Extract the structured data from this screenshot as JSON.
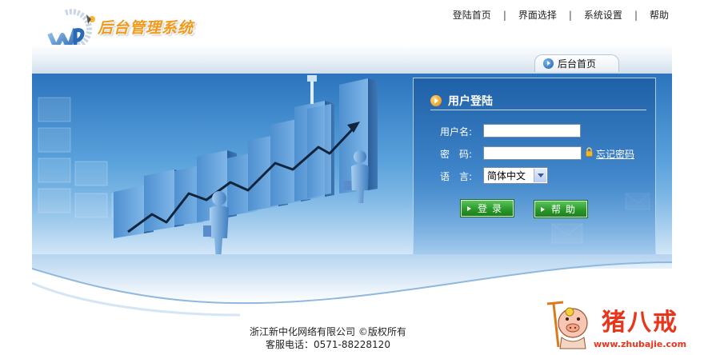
{
  "header": {
    "logo_text": "后台管理系统",
    "nav": [
      "登陆首页",
      "界面选择",
      "系统设置",
      "帮助"
    ],
    "nav_separator": "|"
  },
  "tab": {
    "label": "后台首页"
  },
  "login": {
    "title": "用户登陆",
    "username_label": "用户名:",
    "username_value": "",
    "password_label": "密　码:",
    "password_value": "",
    "forgot_link": "忘记密码",
    "language_label": "语　言:",
    "language_selected": "简体中文",
    "login_button": "登录",
    "help_button": "帮助"
  },
  "footer": {
    "line1": "浙江新中化网络有限公司 ©版权所有",
    "line2": "客服电话：0571-88228120"
  },
  "watermark": {
    "brand": "猪八戒",
    "url": "www.zhubajie.com"
  },
  "colors": {
    "banner_blue": "#2b74bd",
    "logo_orange": "#f29a1b",
    "button_green": "#2a9a2a",
    "watermark_red": "#e8351c"
  }
}
